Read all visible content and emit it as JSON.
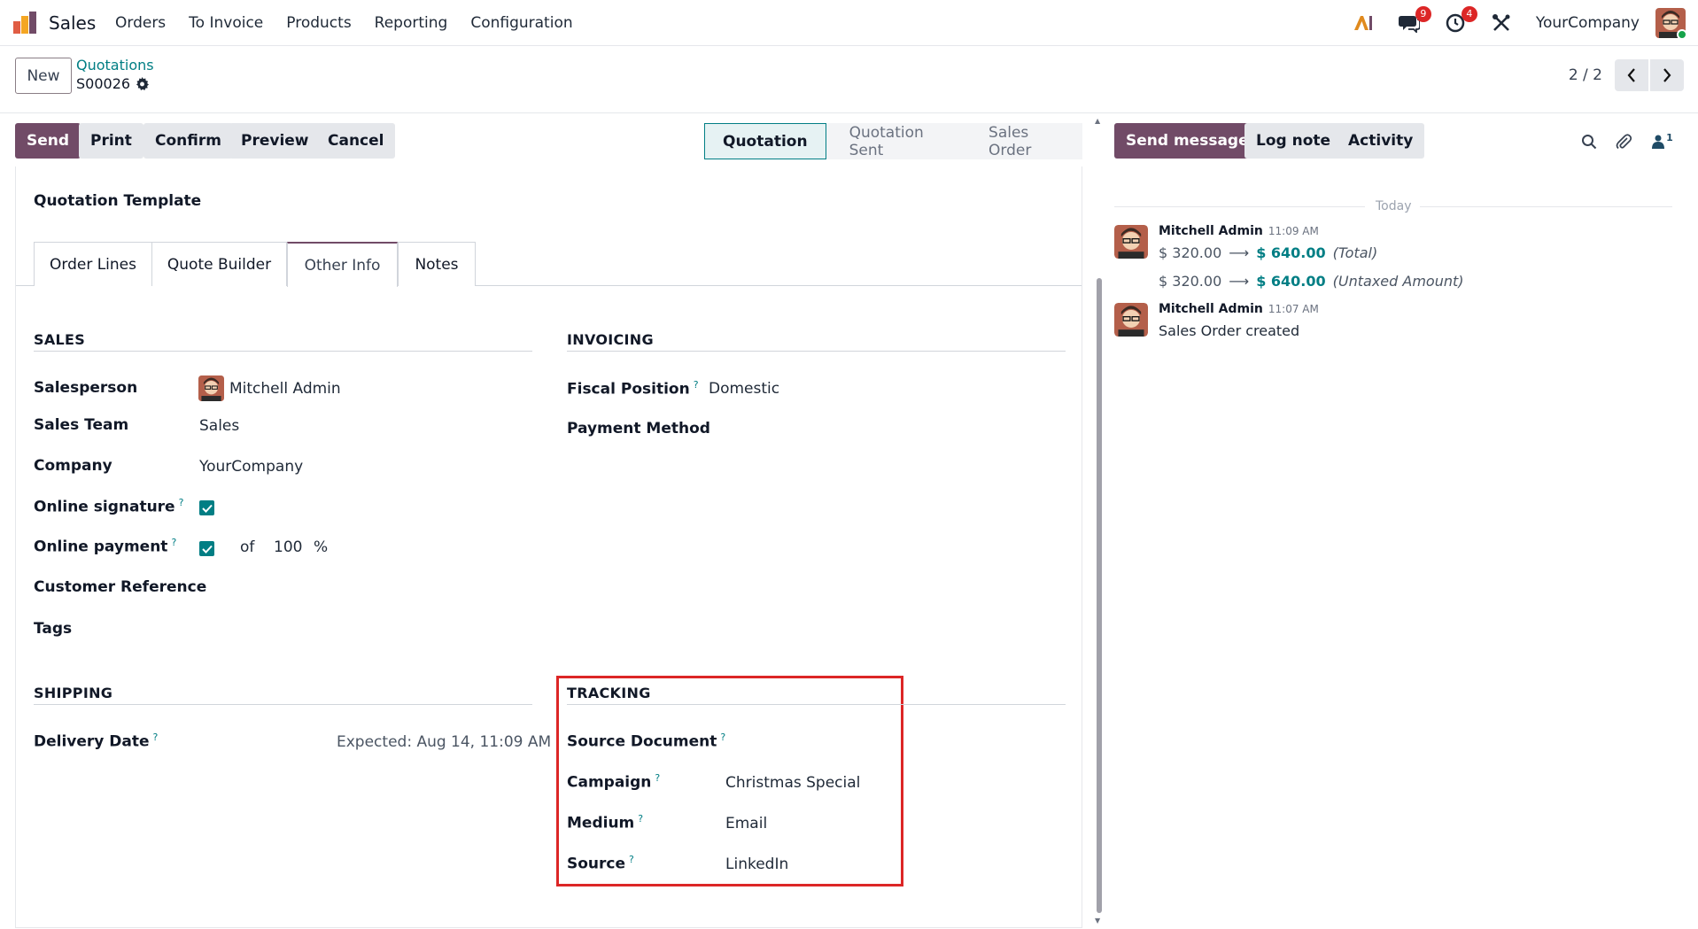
{
  "app": {
    "name": "Sales"
  },
  "menu": [
    "Orders",
    "To Invoice",
    "Products",
    "Reporting",
    "Configuration"
  ],
  "topbar": {
    "messages_count": "9",
    "activities_count": "4",
    "company": "YourCompany"
  },
  "control": {
    "new_label": "New",
    "breadcrumb": "Quotations",
    "record": "S00026",
    "pager": "2 / 2"
  },
  "actions": {
    "send": "Send",
    "print": "Print",
    "confirm": "Confirm",
    "preview": "Preview",
    "cancel": "Cancel"
  },
  "status": [
    "Quotation",
    "Quotation Sent",
    "Sales Order"
  ],
  "form": {
    "quotation_template_label": "Quotation Template",
    "tabs": [
      "Order Lines",
      "Quote Builder",
      "Other Info",
      "Notes"
    ],
    "sales": {
      "title": "SALES",
      "salesperson_label": "Salesperson",
      "salesperson": "Mitchell Admin",
      "team_label": "Sales Team",
      "team": "Sales",
      "company_label": "Company",
      "company": "YourCompany",
      "online_signature_label": "Online signature",
      "online_payment_label": "Online payment",
      "of": "of",
      "percent": "100",
      "percent_sign": "%",
      "customer_ref_label": "Customer Reference",
      "tags_label": "Tags"
    },
    "invoicing": {
      "title": "INVOICING",
      "fiscal_label": "Fiscal Position",
      "fiscal": "Domestic",
      "payment_method_label": "Payment Method"
    },
    "shipping": {
      "title": "SHIPPING",
      "delivery_label": "Delivery Date",
      "delivery": "Expected: Aug 14, 11:09 AM"
    },
    "tracking": {
      "title": "TRACKING",
      "source_doc_label": "Source Document",
      "campaign_label": "Campaign",
      "campaign": "Christmas Special",
      "medium_label": "Medium",
      "medium": "Email",
      "source_label": "Source",
      "source": "LinkedIn"
    }
  },
  "chatter": {
    "send_message": "Send message",
    "log_note": "Log note",
    "activity": "Activity",
    "followers_count": "1",
    "today": "Today",
    "messages": [
      {
        "author": "Mitchell Admin",
        "time": "11:09 AM",
        "changes": [
          {
            "old": "$ 320.00",
            "new": "$ 640.00",
            "field": "(Total)"
          },
          {
            "old": "$ 320.00",
            "new": "$ 640.00",
            "field": "(Untaxed Amount)"
          }
        ]
      },
      {
        "author": "Mitchell Admin",
        "time": "11:07 AM",
        "body": "Sales Order created"
      }
    ]
  },
  "colors": {
    "brand": "#714b67",
    "accent": "#017e84",
    "highlight": "#dc2626"
  }
}
